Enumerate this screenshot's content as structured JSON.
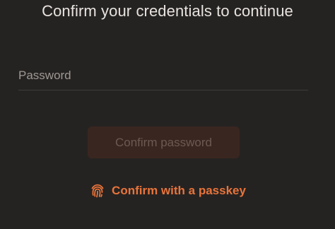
{
  "dialog": {
    "title": "Confirm your credentials to continue"
  },
  "password": {
    "placeholder": "Password",
    "value": ""
  },
  "confirm_button": {
    "label": "Confirm password",
    "state": "disabled"
  },
  "passkey_link": {
    "label": "Confirm with a passkey",
    "icon": "fingerprint-icon"
  },
  "colors": {
    "background": "#252322",
    "accent": "#e8743b",
    "text": "#e7e3df",
    "placeholder": "#9e9893",
    "button_disabled_bg": "#3a2620",
    "button_disabled_text": "#6b5a52"
  }
}
